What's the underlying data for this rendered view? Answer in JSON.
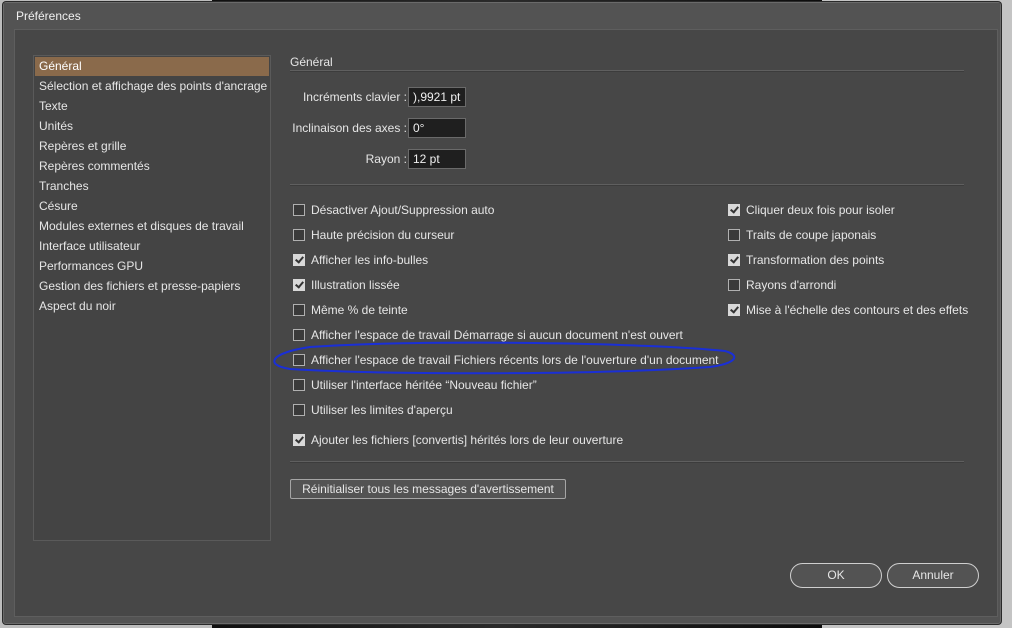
{
  "window": {
    "title": "Préférences"
  },
  "sidebar": {
    "items": [
      {
        "label": "Général",
        "selected": true
      },
      {
        "label": "Sélection et affichage des points d'ancrage"
      },
      {
        "label": "Texte"
      },
      {
        "label": "Unités"
      },
      {
        "label": "Repères et grille"
      },
      {
        "label": "Repères commentés"
      },
      {
        "label": "Tranches"
      },
      {
        "label": "Césure"
      },
      {
        "label": "Modules externes et disques de travail"
      },
      {
        "label": "Interface utilisateur"
      },
      {
        "label": "Performances GPU"
      },
      {
        "label": "Gestion des fichiers et presse-papiers"
      },
      {
        "label": "Aspect du noir"
      }
    ]
  },
  "general": {
    "title": "Général",
    "fields": {
      "increments": {
        "label": "Incréments clavier :",
        "value": "),9921 pt"
      },
      "inclinaison": {
        "label": "Inclinaison des axes :",
        "value": "0°"
      },
      "rayon": {
        "label": "Rayon :",
        "value": "12 pt"
      }
    },
    "left_checks": [
      {
        "label": "Désactiver Ajout/Suppression auto",
        "checked": false
      },
      {
        "label": "Haute précision du curseur",
        "checked": false
      },
      {
        "label": "Afficher les info-bulles",
        "checked": true
      },
      {
        "label": "Illustration lissée",
        "checked": true
      },
      {
        "label": "Même % de teinte",
        "checked": false
      },
      {
        "label": "Afficher l'espace de travail Démarrage si aucun document n'est ouvert",
        "checked": false
      },
      {
        "label": "Afficher l'espace de travail Fichiers récents lors de l'ouverture d'un document",
        "checked": false
      },
      {
        "label": "Utiliser l'interface héritée “Nouveau fichier”",
        "checked": false
      },
      {
        "label": "Utiliser les limites d'aperçu",
        "checked": false
      },
      {
        "label": "Ajouter les fichiers [convertis] hérités lors de leur ouverture",
        "checked": true
      }
    ],
    "right_checks": [
      {
        "label": "Cliquer deux fois pour isoler",
        "checked": true
      },
      {
        "label": "Traits de coupe japonais",
        "checked": false
      },
      {
        "label": "Transformation des points",
        "checked": true
      },
      {
        "label": "Rayons d'arrondi",
        "checked": false
      },
      {
        "label": "Mise à l'échelle des contours et des effets",
        "checked": true
      }
    ],
    "reset_button": "Réinitialiser tous les messages d'avertissement"
  },
  "footer": {
    "ok": "OK",
    "cancel": "Annuler"
  },
  "colors": {
    "selection": "#8a6a4b",
    "annotation": "#1a2fd6",
    "panel": "#535353"
  }
}
